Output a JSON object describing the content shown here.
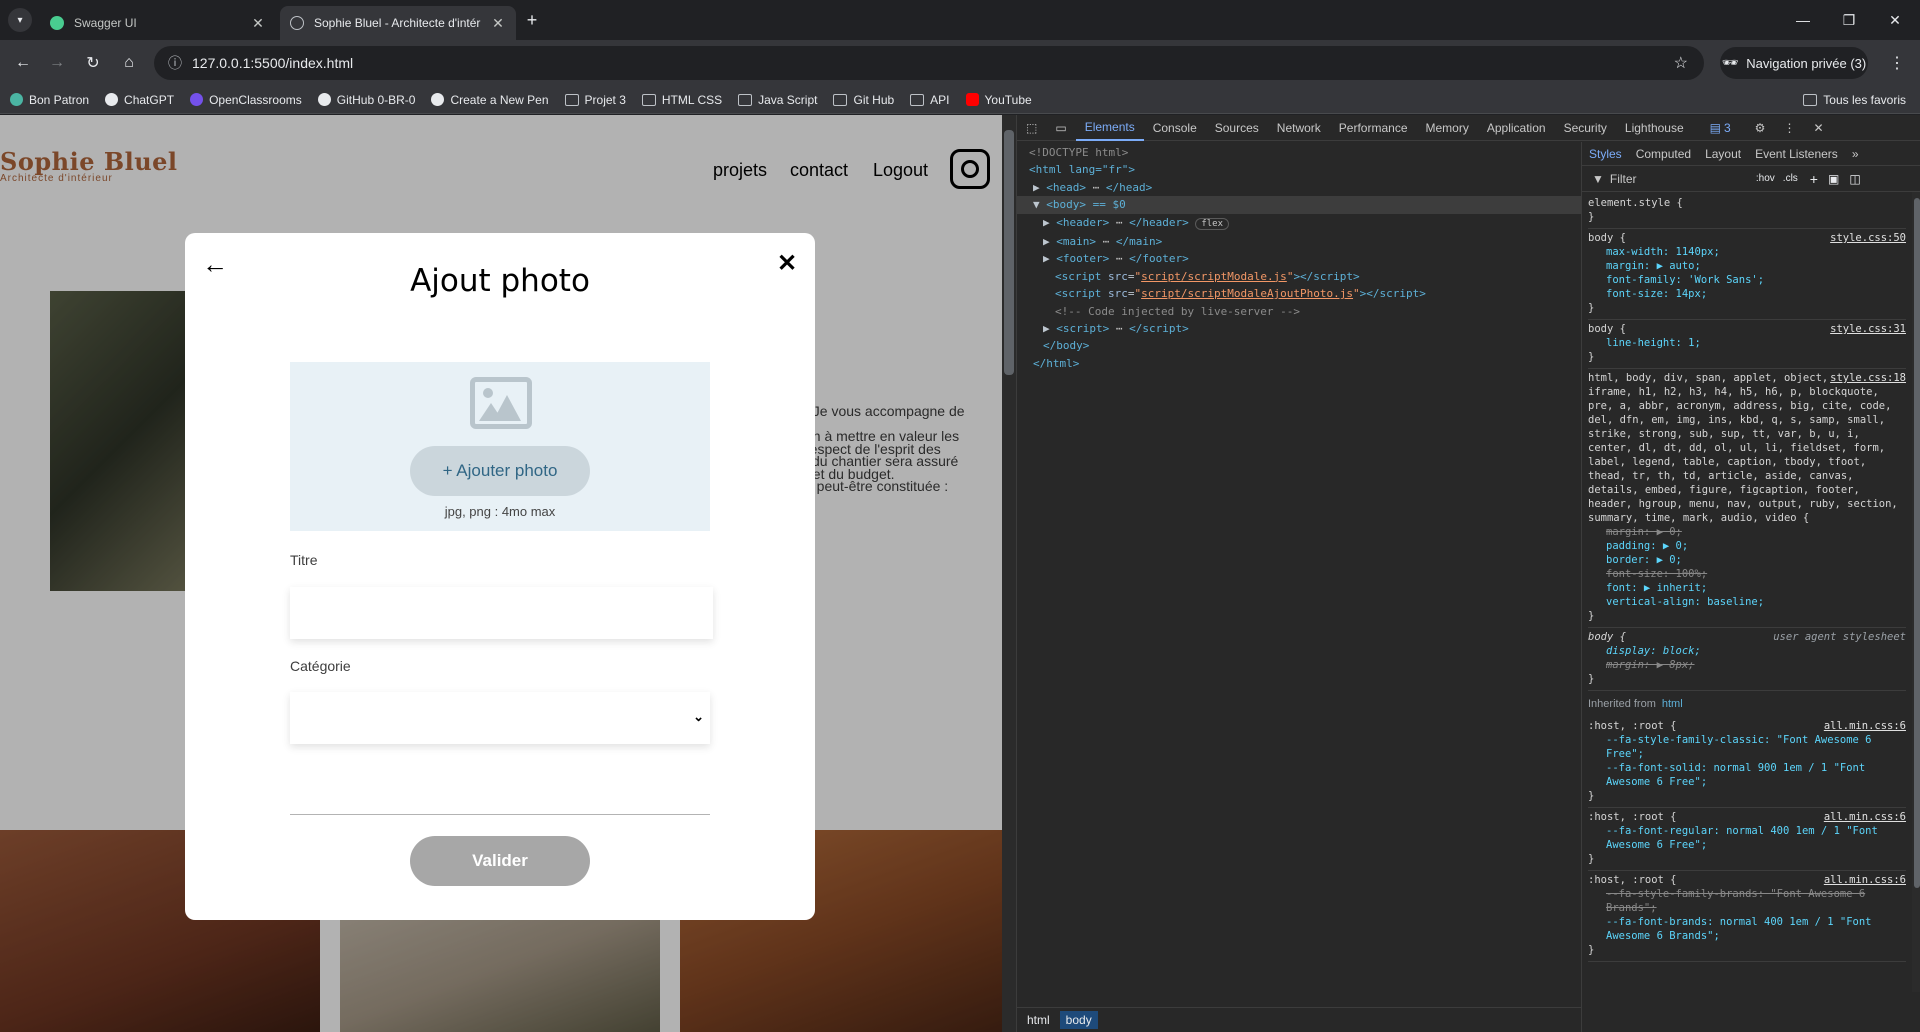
{
  "browser": {
    "tabs": [
      {
        "title": "Swagger UI",
        "active": false
      },
      {
        "title": "Sophie Bluel - Architecte d'intér",
        "active": true
      }
    ],
    "url": "127.0.0.1:5500/index.html",
    "incognito_label": "Navigation privée (3)",
    "bookmarks": [
      {
        "label": "Bon Patron",
        "icon": "bonpatron-icon"
      },
      {
        "label": "ChatGPT",
        "icon": "chatgpt-icon"
      },
      {
        "label": "OpenClassrooms",
        "icon": "openclassrooms-icon"
      },
      {
        "label": "GitHub 0-BR-0",
        "icon": "github-icon"
      },
      {
        "label": "Create a New Pen",
        "icon": "codepen-icon"
      },
      {
        "label": "Projet 3",
        "icon": "folder-icon"
      },
      {
        "label": "HTML CSS",
        "icon": "folder-icon"
      },
      {
        "label": "Java Script",
        "icon": "folder-icon"
      },
      {
        "label": "Git Hub",
        "icon": "folder-icon"
      },
      {
        "label": "API",
        "icon": "folder-icon"
      },
      {
        "label": "YouTube",
        "icon": "youtube-icon"
      }
    ],
    "all_bookmarks": "Tous les favoris"
  },
  "site": {
    "logo": "Sophie Bluel",
    "tagline": "Architecte d'intérieur",
    "nav": [
      "projets",
      "contact",
      "Logout"
    ],
    "intro_lines": [
      ". Je vous accompagne de",
      "",
      "on à mettre en valeur les",
      "respect de l'esprit des",
      "i du chantier sera assuré",
      "t et du budget.",
      "e peut-être constituée :"
    ]
  },
  "modal": {
    "title": "Ajout photo",
    "add_photo_label": "+ Ajouter photo",
    "hint": "jpg, png : 4mo max",
    "titre_label": "Titre",
    "categorie_label": "Catégorie",
    "submit_label": "Valider",
    "colors": {
      "dropzone": "#e8f1f6",
      "add_button_bg": "#cbd6dc",
      "add_button_text": "#306685",
      "submit_bg": "#a7a7a7"
    }
  },
  "devtools": {
    "tabs": [
      "Elements",
      "Console",
      "Sources",
      "Network",
      "Performance",
      "Memory",
      "Application",
      "Security",
      "Lighthouse"
    ],
    "issues_count": "3",
    "dom_lines": [
      "<!DOCTYPE html>",
      "<html lang=\"fr\">",
      "<head>",
      "<body> == $0",
      "<header>",
      "<main>",
      "<footer>",
      "script/scriptModale.js",
      "script/scriptModaleAjoutPhoto.js",
      "<!-- Code injected by live-server -->",
      "<script>",
      "</body>",
      "</html>"
    ],
    "flex_badge": "flex",
    "breadcrumbs": [
      "html",
      "body"
    ],
    "styles_tabs": [
      "Styles",
      "Computed",
      "Layout",
      "Event Listeners"
    ],
    "filter_placeholder": "Filter",
    "hov": ":hov",
    "cls": ".cls",
    "element_style": "element.style {",
    "rules": [
      {
        "selector": "body {",
        "source": "style.css:50",
        "props": [
          "max-width: 1140px;",
          "margin: ▶ auto;",
          "font-family: 'Work Sans';",
          "font-size: 14px;"
        ]
      },
      {
        "selector": "body {",
        "source": "style.css:31",
        "props": [
          "line-height: 1;"
        ]
      },
      {
        "selector": "html, body, div, span, applet, object, iframe, h1, h2, h3, h4, h5, h6, p, blockquote, pre, a, abbr, acronym, address, big, cite, code, del, dfn, em, img, ins, kbd, q, s, samp, small, strike, strong, sub, sup, tt, var, b, u, i, center, dl, dt, dd, ol, ul, li, fieldset, form, label, legend, table, caption, tbody, tfoot, thead, tr, th, td, article, aside, canvas, details, embed, figure, figcaption, footer, header, hgroup, menu, nav, output, ruby, section, summary, time, mark, audio, video {",
        "source": "style.css:18",
        "props": [
          "margin: ▶ 0;",
          "padding: ▶ 0;",
          "border: ▶ 0;",
          "font-size: 100%;",
          "font: ▶ inherit;",
          "vertical-align: baseline;"
        ]
      },
      {
        "selector": "body {",
        "source": "user agent stylesheet",
        "props": [
          "display: block;",
          "margin: ▶ 8px;"
        ]
      }
    ],
    "inherited_label": "Inherited from",
    "inherited_from": "html",
    "root_rules": [
      {
        "selector": ":host, :root {",
        "source": "all.min.css:6",
        "props": [
          "--fa-style-family-classic: \"Font Awesome 6 Free\";",
          "--fa-font-solid: normal 900 1em / 1 \"Font Awesome 6 Free\";"
        ]
      },
      {
        "selector": ":host, :root {",
        "source": "all.min.css:6",
        "props": [
          "--fa-font-regular: normal 400 1em / 1 \"Font Awesome 6 Free\";"
        ]
      },
      {
        "selector": ":host, :root {",
        "source": "all.min.css:6",
        "props": [
          "--fa-style-family-brands: \"Font Awesome 6 Brands\";",
          "--fa-font-brands: normal 400 1em / 1 \"Font Awesome 6 Brands\";"
        ]
      }
    ]
  }
}
